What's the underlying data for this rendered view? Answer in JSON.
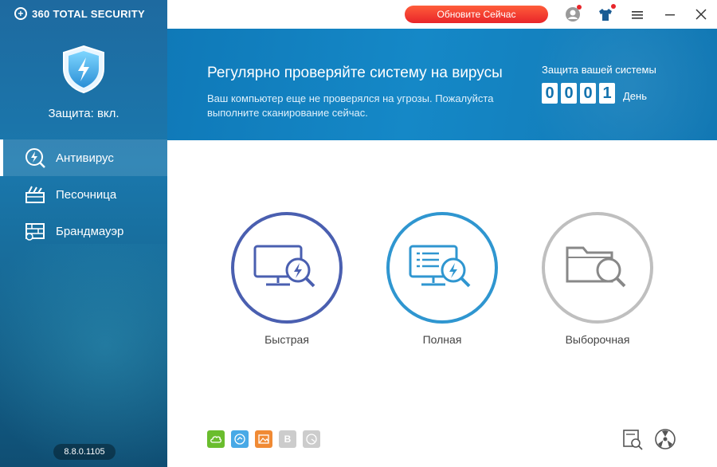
{
  "app": {
    "brand": "360 TOTAL SECURITY",
    "version": "8.8.0.1105"
  },
  "sidebar": {
    "status": "Защита: вкл.",
    "items": [
      {
        "label": "Антивирус",
        "icon": "antivirus-icon",
        "active": true
      },
      {
        "label": "Песочница",
        "icon": "sandbox-icon",
        "active": false
      },
      {
        "label": "Брандмауэр",
        "icon": "firewall-icon",
        "active": false
      }
    ]
  },
  "topbar": {
    "update_label": "Обновите Сейчас"
  },
  "banner": {
    "title": "Регулярно проверяйте систему на вирусы",
    "subtitle": "Ваш компьютер еще не проверялся на угрозы. Пожалуйста выполните сканирование сейчас.",
    "days_label": "Защита вашей системы",
    "days_digits": [
      "0",
      "0",
      "0",
      "1"
    ],
    "days_unit": "День"
  },
  "scans": [
    {
      "label": "Быстрая",
      "icon": "quick-scan-icon",
      "color": "#4a5fb0"
    },
    {
      "label": "Полная",
      "icon": "full-scan-icon",
      "color": "#2f96d0"
    },
    {
      "label": "Выборочная",
      "icon": "custom-scan-icon",
      "color": "#bfbfbf"
    }
  ],
  "tools": [
    {
      "icon": "cloud-icon",
      "color": "#6abd2e"
    },
    {
      "icon": "speed-icon",
      "color": "#48a9e6"
    },
    {
      "icon": "image-icon",
      "color": "#f08a34"
    },
    {
      "icon": "b-icon",
      "color": "#cccccc",
      "glyph": "B"
    },
    {
      "icon": "gauge-icon",
      "color": "#cccccc"
    }
  ],
  "colors": {
    "accent": "#1588c7",
    "update": "#e8252a",
    "sidebar": "#1a78ad"
  }
}
